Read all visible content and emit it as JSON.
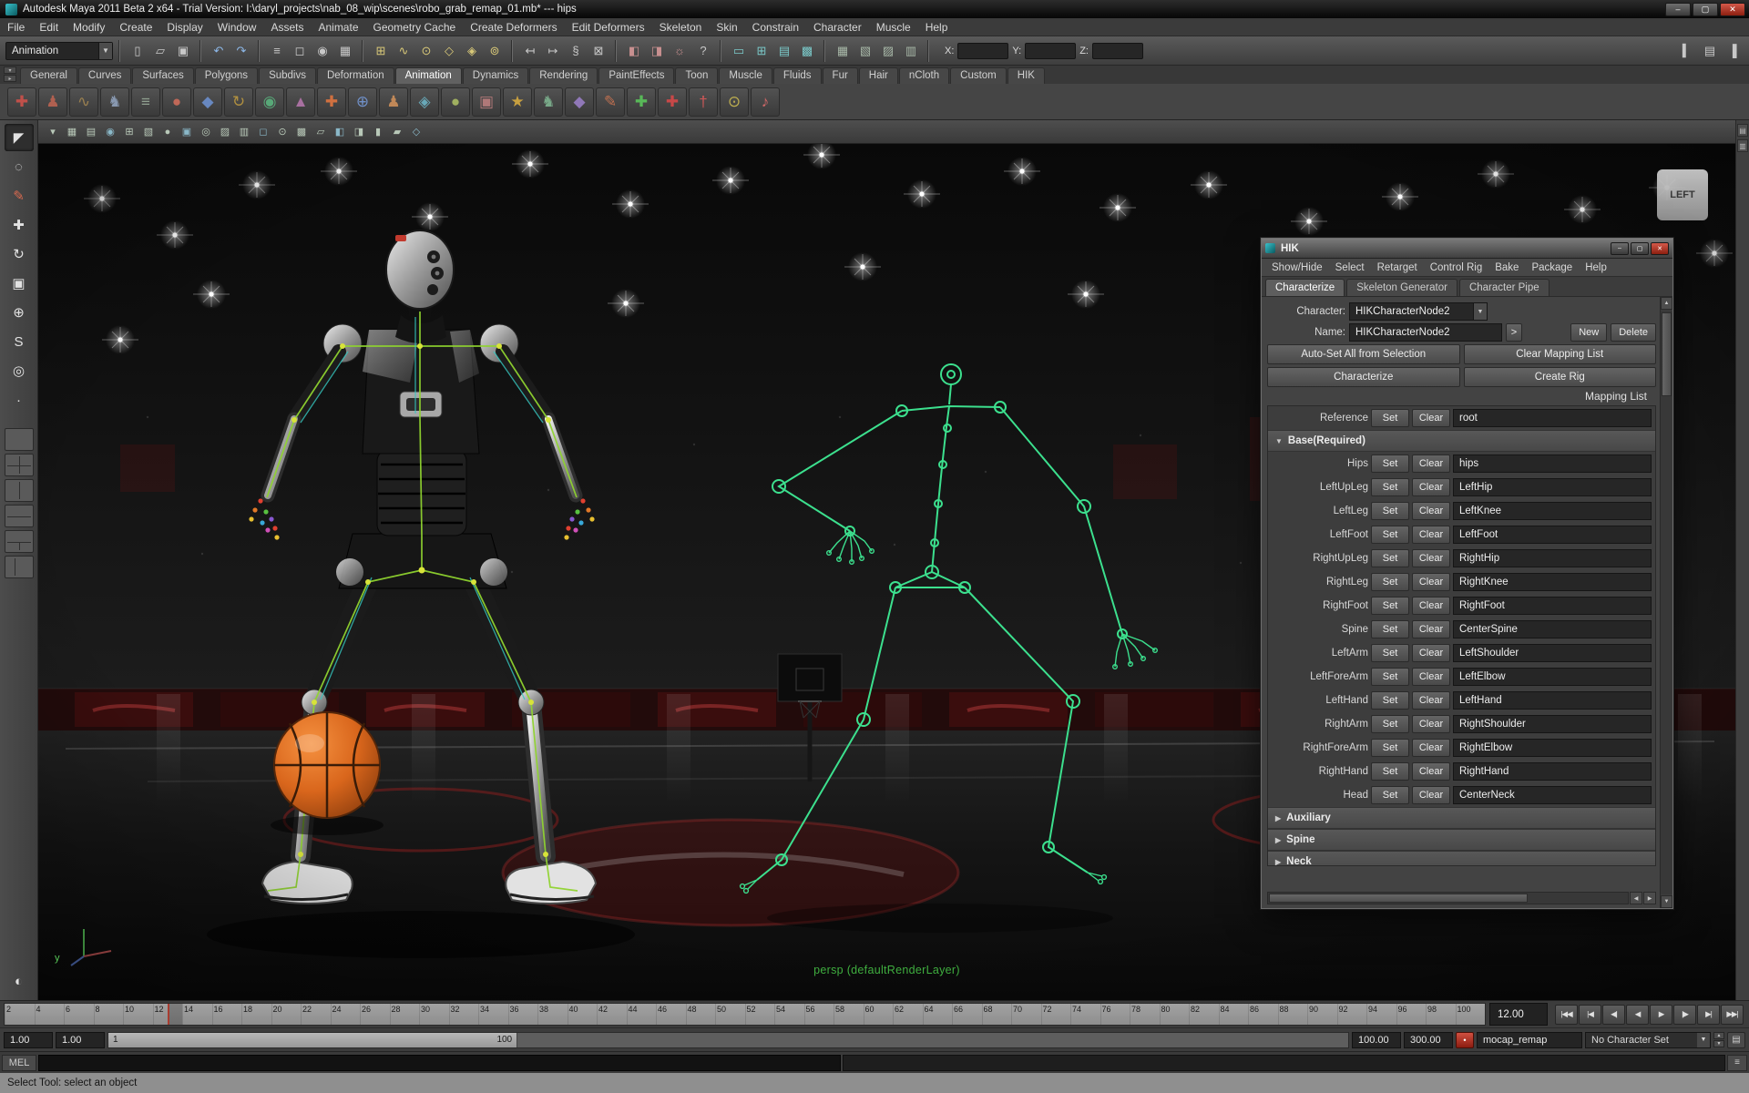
{
  "titlebar": {
    "title": "Autodesk Maya 2011 Beta 2 x64 - Trial Version: I:\\daryl_projects\\nab_08_wip\\scenes\\robo_grab_remap_01.mb*   ---   hips"
  },
  "menubar": {
    "items": [
      "File",
      "Edit",
      "Modify",
      "Create",
      "Display",
      "Window",
      "Assets",
      "Animate",
      "Geometry Cache",
      "Create Deformers",
      "Edit Deformers",
      "Skeleton",
      "Skin",
      "Constrain",
      "Character",
      "Muscle",
      "Help"
    ]
  },
  "statusline": {
    "menu_set": "Animation",
    "g_file": [
      {
        "n": "new-scene-icon",
        "g": "▯"
      },
      {
        "n": "open-scene-icon",
        "g": "▱"
      },
      {
        "n": "save-scene-icon",
        "g": "▣"
      }
    ],
    "g_undo": [
      {
        "n": "undo-icon",
        "g": "↶"
      },
      {
        "n": "redo-icon",
        "g": "↷"
      }
    ],
    "g_select": [
      {
        "n": "select-by-hierarchy-icon",
        "g": "≡"
      },
      {
        "n": "select-by-object-icon",
        "g": "◻"
      },
      {
        "n": "select-by-component-icon",
        "g": "◉"
      },
      {
        "n": "selection-mask-icon",
        "g": "▦"
      }
    ],
    "g_snap": [
      {
        "n": "snap-to-grid-icon",
        "g": "⊞"
      },
      {
        "n": "snap-to-curve-icon",
        "g": "∿"
      },
      {
        "n": "snap-to-point-icon",
        "g": "⊙"
      },
      {
        "n": "snap-to-view-plane-icon",
        "g": "◇"
      },
      {
        "n": "make-live-icon",
        "g": "◈"
      },
      {
        "n": "snap-to-center-icon",
        "g": "⊚"
      }
    ],
    "g_hist": [
      {
        "n": "input-connections-icon",
        "g": "↤"
      },
      {
        "n": "output-connections-icon",
        "g": "↦"
      },
      {
        "n": "construction-history-icon",
        "g": "§"
      },
      {
        "n": "selection-lock-icon",
        "g": "⊠"
      }
    ],
    "g_render": [
      {
        "n": "render-current-frame-icon",
        "g": "◧"
      },
      {
        "n": "ipr-render-icon",
        "g": "◨"
      },
      {
        "n": "render-settings-icon",
        "g": "☼"
      }
    ],
    "g_help": [
      {
        "n": "quick-help-icon",
        "g": "?"
      }
    ],
    "g_panel": [
      {
        "n": "single-pane-layout-icon",
        "g": "▭"
      },
      {
        "n": "four-pane-layout-icon",
        "g": "⊞"
      },
      {
        "n": "outliner-panel-icon",
        "g": "▤"
      },
      {
        "n": "hypergraph-panel-icon",
        "g": "▩"
      }
    ],
    "g_grid": [
      {
        "n": "grid-display-icon",
        "g": "▦"
      },
      {
        "n": "film-gate-icon",
        "g": "▧"
      },
      {
        "n": "resolution-gate-icon",
        "g": "▨"
      },
      {
        "n": "safe-action-icon",
        "g": "▥"
      }
    ],
    "coords": {
      "x_label": "X:",
      "y_label": "Y:",
      "z_label": "Z:",
      "x_value": "",
      "y_value": "",
      "z_value": ""
    },
    "right_icons": [
      {
        "n": "show-attribute-editor-icon",
        "g": "▍"
      },
      {
        "n": "show-tool-settings-icon",
        "g": "▤"
      },
      {
        "n": "show-channel-box-icon",
        "g": "▐"
      }
    ]
  },
  "shelf": {
    "tabs": [
      {
        "label": "General",
        "active": "false"
      },
      {
        "label": "Curves",
        "active": "false"
      },
      {
        "label": "Surfaces",
        "active": "false"
      },
      {
        "label": "Polygons",
        "active": "false"
      },
      {
        "label": "Subdivs",
        "active": "false"
      },
      {
        "label": "Deformation",
        "active": "false"
      },
      {
        "label": "Animation",
        "active": "true"
      },
      {
        "label": "Dynamics",
        "active": "false"
      },
      {
        "label": "Rendering",
        "active": "false"
      },
      {
        "label": "PaintEffects",
        "active": "false"
      },
      {
        "label": "Toon",
        "active": "false"
      },
      {
        "label": "Muscle",
        "active": "false"
      },
      {
        "label": "Fluids",
        "active": "false"
      },
      {
        "label": "Fur",
        "active": "false"
      },
      {
        "label": "Hair",
        "active": "false"
      },
      {
        "label": "nCloth",
        "active": "false"
      },
      {
        "label": "Custom",
        "active": "false"
      },
      {
        "label": "HIK",
        "active": "false"
      }
    ],
    "icons": [
      {
        "g": "✚",
        "c": "#c0504a"
      },
      {
        "g": "♟",
        "c": "#b06050"
      },
      {
        "g": "∿",
        "c": "#9a8050"
      },
      {
        "g": "♞",
        "c": "#8898b0"
      },
      {
        "g": "≡",
        "c": "#90a090"
      },
      {
        "g": "●",
        "c": "#c06858"
      },
      {
        "g": "◆",
        "c": "#6888c0"
      },
      {
        "g": "↻",
        "c": "#b09040"
      },
      {
        "g": "◉",
        "c": "#58a878"
      },
      {
        "g": "▲",
        "c": "#a870a0"
      },
      {
        "g": "✚",
        "c": "#d07040"
      },
      {
        "g": "⊕",
        "c": "#7090c8"
      },
      {
        "g": "♟",
        "c": "#c08858"
      },
      {
        "g": "◈",
        "c": "#68a8b8"
      },
      {
        "g": "●",
        "c": "#a0b060"
      },
      {
        "g": "▣",
        "c": "#b07878"
      },
      {
        "g": "★",
        "c": "#c8a040"
      },
      {
        "g": "♞",
        "c": "#78a888"
      },
      {
        "g": "◆",
        "c": "#9078b8"
      },
      {
        "g": "✎",
        "c": "#c07050"
      },
      {
        "g": "✚",
        "c": "#58b858"
      },
      {
        "g": "✚",
        "c": "#c84848"
      },
      {
        "g": "†",
        "c": "#d05858"
      },
      {
        "g": "⊙",
        "c": "#c0b050"
      },
      {
        "g": "♪",
        "c": "#d06868"
      }
    ]
  },
  "toolbox": {
    "tools": [
      {
        "n": "select-tool-icon",
        "g": "◤",
        "a": "true"
      },
      {
        "n": "lasso-select-tool-icon",
        "g": "◌",
        "a": "false"
      },
      {
        "n": "paint-select-tool-icon",
        "g": "✎",
        "a": "false"
      },
      {
        "n": "move-tool-icon",
        "g": "✚",
        "a": "false"
      },
      {
        "n": "rotate-tool-icon",
        "g": "↻",
        "a": "false"
      },
      {
        "n": "scale-tool-icon",
        "g": "▣",
        "a": "false"
      },
      {
        "n": "universal-manipulator-icon",
        "g": "⊕",
        "a": "false"
      },
      {
        "n": "soft-modification-icon",
        "g": "S",
        "a": "false"
      },
      {
        "n": "show-manipulator-icon",
        "g": "◎",
        "a": "false"
      },
      {
        "n": "last-tool-icon",
        "g": "·",
        "a": "false"
      }
    ]
  },
  "panelbar": {
    "icons": [
      {
        "g": "▾"
      },
      {
        "g": "▦"
      },
      {
        "g": "▤"
      },
      {
        "g": "◉"
      },
      {
        "g": "⊞"
      },
      {
        "g": "▧"
      },
      {
        "g": "●"
      },
      {
        "g": "▣"
      },
      {
        "g": "◎"
      },
      {
        "g": "▨"
      },
      {
        "g": "▥"
      },
      {
        "g": "◻"
      },
      {
        "g": "⊙"
      },
      {
        "g": "▩"
      },
      {
        "g": "▱"
      },
      {
        "g": "◧"
      },
      {
        "g": "◨"
      },
      {
        "g": "▮"
      },
      {
        "g": "▰"
      },
      {
        "g": "◇"
      }
    ]
  },
  "rightstrip": {
    "icons": [
      {
        "n": "channel-box-tab-icon",
        "g": "▤"
      },
      {
        "n": "layer-editor-tab-icon",
        "g": "▥"
      }
    ]
  },
  "viewport": {
    "camera_label": "persp (defaultRenderLayer)",
    "view_label": "LEFT",
    "axis_label": "y"
  },
  "hik": {
    "title": "HIK",
    "menus": [
      "Show/Hide",
      "Select",
      "Retarget",
      "Control Rig",
      "Bake",
      "Package",
      "Help"
    ],
    "tabs": [
      {
        "label": "Characterize",
        "active": "true"
      },
      {
        "label": "Skeleton Generator",
        "active": "false"
      },
      {
        "label": "Character Pipe",
        "active": "false"
      }
    ],
    "character_label": "Character:",
    "character_value": "HIKCharacterNode2",
    "name_label": "Name:",
    "name_value": "HIKCharacterNode2",
    "arrow_button": ">",
    "new_button": "New",
    "delete_button": "Delete",
    "autoset_button": "Auto-Set All from Selection",
    "clear_mapping_button": "Clear Mapping List",
    "characterize_button": "Characterize",
    "create_rig_button": "Create Rig",
    "mapping_list_label": "Mapping List",
    "set_label": "Set",
    "clear_label": "Clear",
    "reference_row": {
      "slot": "Reference",
      "value": "root"
    },
    "base_section": "Base(Required)",
    "rows": [
      {
        "slot": "Hips",
        "value": "hips"
      },
      {
        "slot": "LeftUpLeg",
        "value": "LeftHip"
      },
      {
        "slot": "LeftLeg",
        "value": "LeftKnee"
      },
      {
        "slot": "LeftFoot",
        "value": "LeftFoot"
      },
      {
        "slot": "RightUpLeg",
        "value": "RightHip"
      },
      {
        "slot": "RightLeg",
        "value": "RightKnee"
      },
      {
        "slot": "RightFoot",
        "value": "RightFoot"
      },
      {
        "slot": "Spine",
        "value": "CenterSpine"
      },
      {
        "slot": "LeftArm",
        "value": "LeftShoulder"
      },
      {
        "slot": "LeftForeArm",
        "value": "LeftElbow"
      },
      {
        "slot": "LeftHand",
        "value": "LeftHand"
      },
      {
        "slot": "RightArm",
        "value": "RightShoulder"
      },
      {
        "slot": "RightForeArm",
        "value": "RightElbow"
      },
      {
        "slot": "RightHand",
        "value": "RightHand"
      },
      {
        "slot": "Head",
        "value": "CenterNeck"
      }
    ],
    "collapsed_sections": [
      "Auxiliary",
      "Spine",
      "Neck"
    ]
  },
  "timeline": {
    "ticks": [
      "2",
      "4",
      "6",
      "8",
      "10",
      "12",
      "14",
      "16",
      "18",
      "20",
      "22",
      "24",
      "26",
      "28",
      "30",
      "32",
      "34",
      "36",
      "38",
      "40",
      "42",
      "44",
      "46",
      "48",
      "50",
      "52",
      "54",
      "56",
      "58",
      "60",
      "62",
      "64",
      "66",
      "68",
      "70",
      "72",
      "74",
      "76",
      "78",
      "80",
      "82",
      "84",
      "86",
      "88",
      "90",
      "92",
      "94",
      "96",
      "98",
      "100"
    ],
    "current_frame": "12.00"
  },
  "range": {
    "anim_start": "1.00",
    "playback_start": "1.00",
    "bar_start": "1",
    "bar_end": "100",
    "playback_end": "100.00",
    "anim_end": "300.00",
    "character_field": "mocap_remap",
    "character_set": "No Character Set"
  },
  "command": {
    "label": "MEL",
    "value": "",
    "result": ""
  },
  "helpline": {
    "text": "Select Tool: select an object"
  }
}
